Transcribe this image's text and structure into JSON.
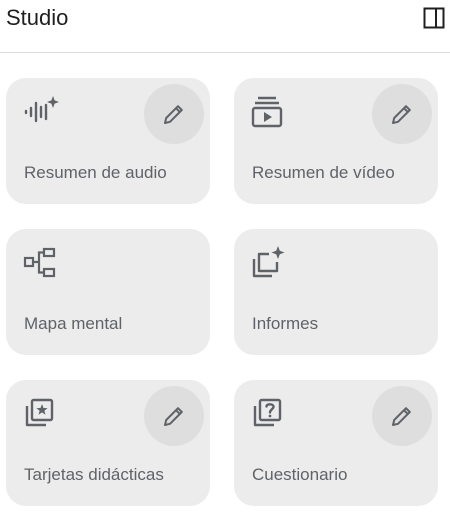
{
  "header": {
    "title": "Studio"
  },
  "cards": [
    {
      "label": "Resumen de audio",
      "icon": "audio-sparkle-icon",
      "has_edit": true
    },
    {
      "label": "Resumen de vídeo",
      "icon": "video-collection-icon",
      "has_edit": true
    },
    {
      "label": "Mapa mental",
      "icon": "mind-map-icon",
      "has_edit": false
    },
    {
      "label": "Informes",
      "icon": "report-sparkle-icon",
      "has_edit": false
    },
    {
      "label": "Tarjetas didácticas",
      "icon": "flashcards-star-icon",
      "has_edit": true
    },
    {
      "label": "Cuestionario",
      "icon": "quiz-question-icon",
      "has_edit": true
    }
  ],
  "colors": {
    "card_background": "#ececec",
    "edit_button_background": "#dedede",
    "icon": "#5f6368",
    "title": "#1f1f1f",
    "divider": "#dadce0"
  }
}
